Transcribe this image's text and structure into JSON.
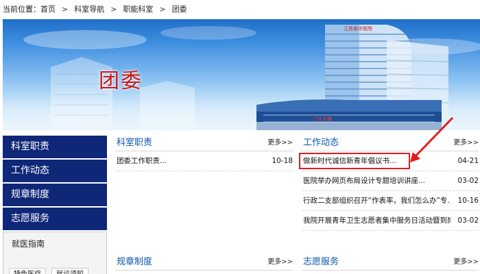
{
  "breadcrumb": {
    "label": "当前位置：",
    "items": [
      "首页",
      "科室导航",
      "职能科室",
      "团委"
    ],
    "separator": ">"
  },
  "banner": {
    "title": "团委",
    "hospital_sign": "江苏省中医院",
    "building_sign": "门诊大楼"
  },
  "sidebar": {
    "items": [
      "科室职责",
      "工作动态",
      "规章制度",
      "志愿服务"
    ],
    "guide": {
      "title": "就医指南",
      "buttons": [
        "特色医疗",
        "就诊须知"
      ]
    }
  },
  "panels": {
    "duties": {
      "title": "科室职责",
      "more": "更多>>",
      "rows": [
        {
          "text": "团委工作职责...",
          "date": "10-18"
        }
      ]
    },
    "work": {
      "title": "工作动态",
      "more": "更多>>",
      "rows": [
        {
          "text": "做新时代诚信新青年倡议书...",
          "date": "04-21"
        },
        {
          "text": "医院举办网页布局设计专题培训讲座...",
          "date": "03-02"
        },
        {
          "text": "行政二支部组织召开“作表率，我们怎么办”专...",
          "date": "10-16"
        },
        {
          "text": "我院开展青年卫生志愿者集中服务日活动暨到岗...",
          "date": "03-02"
        }
      ]
    },
    "rules": {
      "title": "规章制度",
      "more": "更多>>"
    },
    "volunteer": {
      "title": "志愿服务",
      "more": "更多>>"
    }
  },
  "colors": {
    "sidebar_bg": "#0f2777",
    "panel_title": "#0c57ad",
    "annotation": "#e21b1b"
  }
}
